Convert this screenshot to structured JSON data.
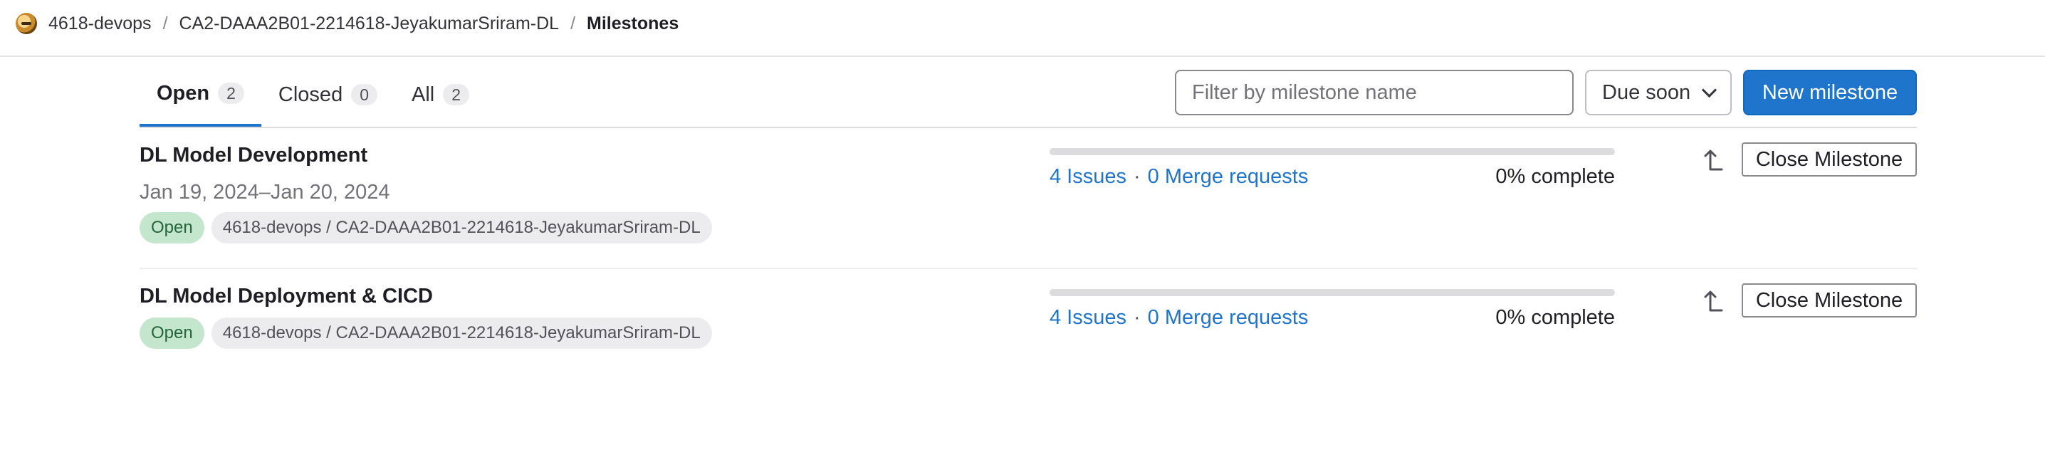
{
  "breadcrumb": {
    "items": [
      "4618-devops",
      "CA2-DAAA2B01-2214618-JeyakumarSriram-DL"
    ],
    "current": "Milestones",
    "separator": "/"
  },
  "tabs": [
    {
      "label": "Open",
      "count": "2",
      "active": true
    },
    {
      "label": "Closed",
      "count": "0",
      "active": false
    },
    {
      "label": "All",
      "count": "2",
      "active": false
    }
  ],
  "filter": {
    "placeholder": "Filter by milestone name",
    "value": ""
  },
  "sort": {
    "label": "Due soon",
    "icon": "chevron-down-icon"
  },
  "new_button": {
    "label": "New milestone"
  },
  "milestones": [
    {
      "title": "DL Model Development",
      "dates": "Jan 19, 2024–Jan 20, 2024",
      "status": "Open",
      "project_path": "4618-devops / CA2-DAAA2B01-2214618-JeyakumarSriram-DL",
      "issues": "4 Issues",
      "merge_requests": "0 Merge requests",
      "complete_text": "0% complete",
      "progress": 0,
      "action_label": "Close Milestone"
    },
    {
      "title": "DL Model Deployment & CICD",
      "dates": "",
      "status": "Open",
      "project_path": "4618-devops / CA2-DAAA2B01-2214618-JeyakumarSriram-DL",
      "issues": "4 Issues",
      "merge_requests": "0 Merge requests",
      "complete_text": "0% complete",
      "progress": 0,
      "action_label": "Close Milestone"
    }
  ],
  "link_separator": "·",
  "colors": {
    "accent": "#1f75cb",
    "status_open_bg": "#c3e6cd",
    "status_open_text": "#24663b"
  }
}
